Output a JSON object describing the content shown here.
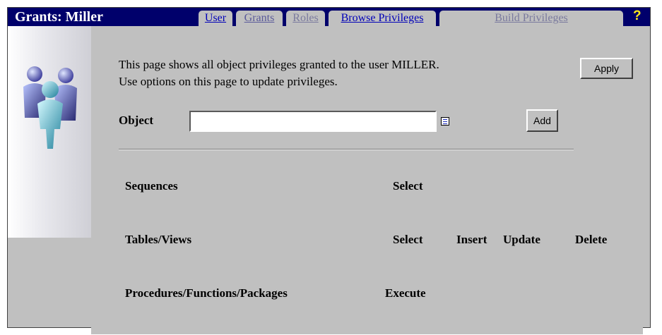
{
  "header": {
    "title": "Grants: Miller",
    "help": "?",
    "tabs": [
      {
        "label": "User"
      },
      {
        "label": "Grants"
      },
      {
        "label": "Roles"
      },
      {
        "label": "Browse Privileges"
      },
      {
        "label": "Build Privileges"
      }
    ]
  },
  "main": {
    "intro_line1": "This page shows all object privileges granted to the user MILLER.",
    "intro_line2": "Use options on this page to update privileges.",
    "apply_label": "Apply",
    "object_label": "Object",
    "object_value": "",
    "add_label": "Add",
    "sections": [
      {
        "name": "Sequences",
        "privileges": [
          "Select"
        ]
      },
      {
        "name": "Tables/Views",
        "privileges": [
          "Select",
          "Insert",
          "Update",
          "Delete"
        ]
      },
      {
        "name": "Procedures/Functions/Packages",
        "privileges": [
          "Execute"
        ]
      }
    ]
  },
  "colors": {
    "titlebar": "#00006b",
    "panel": "#c0c0c0",
    "link": "#0000b8",
    "help": "#ffe81a"
  },
  "icons": {
    "users_graphic": "users-group-icon",
    "list_of_values": "list-of-values-icon",
    "help": "help-icon"
  }
}
